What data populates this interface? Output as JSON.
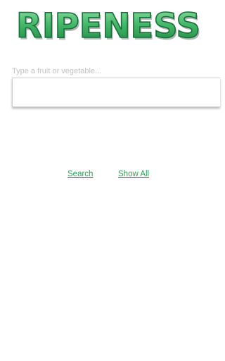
{
  "app": {
    "logo_text": "RIPENESS"
  },
  "search": {
    "label": "Type a fruit or vegetable...",
    "value": ""
  },
  "actions": {
    "search_label": "Search",
    "show_all_label": "Show All"
  },
  "colors": {
    "logo_green_light": "#6fd08c",
    "logo_green_dark": "#1e8a45",
    "link_green": "#2e9e55"
  }
}
